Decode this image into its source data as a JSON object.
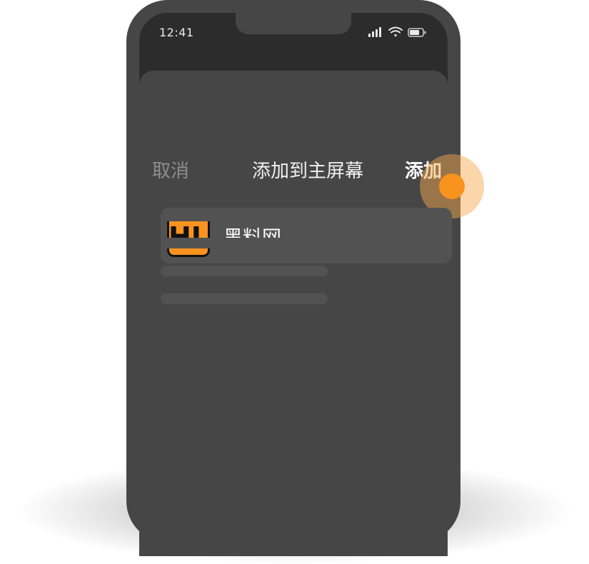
{
  "status_bar": {
    "time": "12:41",
    "icons": [
      "signal-icon",
      "wifi-icon",
      "battery-icon"
    ]
  },
  "add_to_home_sheet": {
    "cancel_label": "取消",
    "title": "添加到主屏幕",
    "add_label": "添加"
  },
  "app": {
    "icon_text": "HL",
    "name": "黑料网",
    "icon_color": "#f7931e"
  },
  "colors": {
    "phone_body": "#464646",
    "accent": "#f7931e"
  }
}
